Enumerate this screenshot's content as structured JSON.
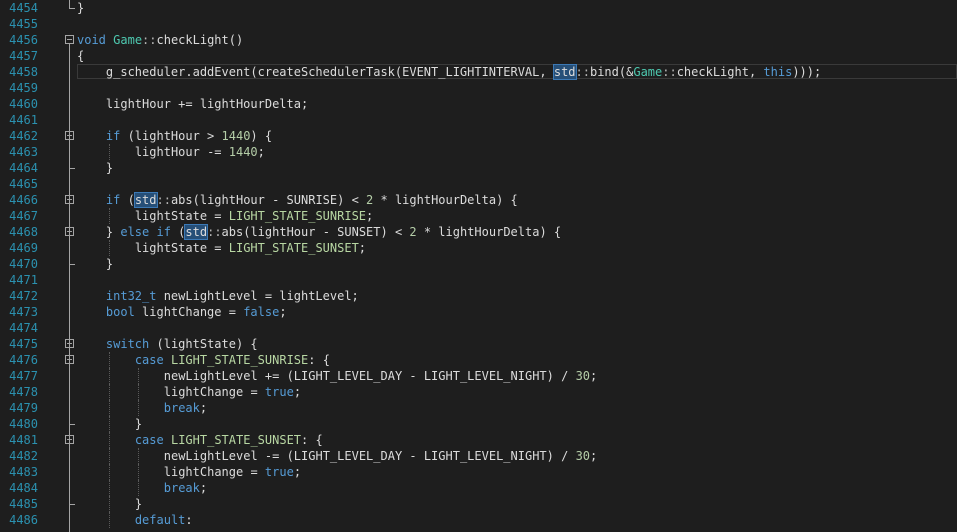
{
  "editor": {
    "lines": [
      {
        "n": "4454",
        "fold": "end",
        "ind": 0,
        "t": [
          [
            "p",
            "}"
          ]
        ]
      },
      {
        "n": "4455",
        "ind": 0,
        "t": []
      },
      {
        "n": "4456",
        "fold": "open",
        "ind": 0,
        "t": [
          [
            "kw",
            "void"
          ],
          [
            "p",
            " "
          ],
          [
            "ty",
            "Game"
          ],
          [
            "op",
            "::"
          ],
          [
            "p",
            "checkLight()"
          ]
        ]
      },
      {
        "n": "4457",
        "ind": 0,
        "t": [
          [
            "p",
            "{"
          ]
        ]
      },
      {
        "n": "4458",
        "ind": 1,
        "current": true,
        "t": [
          [
            "p",
            "g_scheduler.addEvent(createSchedulerTask(EVENT_LIGHTINTERVAL, "
          ],
          [
            "hl",
            "std"
          ],
          [
            "op",
            "::"
          ],
          [
            "p",
            "bind(&"
          ],
          [
            "ty",
            "Game"
          ],
          [
            "op",
            "::"
          ],
          [
            "p",
            "checkLight, "
          ],
          [
            "kw",
            "this"
          ],
          [
            "p",
            ")));"
          ]
        ]
      },
      {
        "n": "4459",
        "ind": 1,
        "t": []
      },
      {
        "n": "4460",
        "ind": 1,
        "t": [
          [
            "p",
            "lightHour += lightHourDelta;"
          ]
        ]
      },
      {
        "n": "4461",
        "ind": 1,
        "t": []
      },
      {
        "n": "4462",
        "fold": "open",
        "ind": 1,
        "t": [
          [
            "kw",
            "if"
          ],
          [
            "p",
            " (lightHour > "
          ],
          [
            "num",
            "1440"
          ],
          [
            "p",
            ") {"
          ]
        ]
      },
      {
        "n": "4463",
        "ind": 2,
        "t": [
          [
            "p",
            "lightHour -= "
          ],
          [
            "num",
            "1440"
          ],
          [
            "p",
            ";"
          ]
        ]
      },
      {
        "n": "4464",
        "fold": "end",
        "ind": 1,
        "t": [
          [
            "p",
            "}"
          ]
        ]
      },
      {
        "n": "4465",
        "ind": 1,
        "t": []
      },
      {
        "n": "4466",
        "fold": "open",
        "ind": 1,
        "t": [
          [
            "kw",
            "if"
          ],
          [
            "p",
            " ("
          ],
          [
            "hl",
            "std"
          ],
          [
            "op",
            "::"
          ],
          [
            "p",
            "abs(lightHour - SUNRISE) < "
          ],
          [
            "num",
            "2"
          ],
          [
            "p",
            " * lightHourDelta) {"
          ]
        ]
      },
      {
        "n": "4467",
        "ind": 2,
        "t": [
          [
            "p",
            "lightState = "
          ],
          [
            "en",
            "LIGHT_STATE_SUNRISE"
          ],
          [
            "p",
            ";"
          ]
        ]
      },
      {
        "n": "4468",
        "fold": "open",
        "ind": 1,
        "t": [
          [
            "p",
            "} "
          ],
          [
            "kw",
            "else"
          ],
          [
            "p",
            " "
          ],
          [
            "kw",
            "if"
          ],
          [
            "p",
            " ("
          ],
          [
            "hl",
            "std"
          ],
          [
            "op",
            "::"
          ],
          [
            "p",
            "abs(lightHour - SUNSET) < "
          ],
          [
            "num",
            "2"
          ],
          [
            "p",
            " * lightHourDelta) {"
          ]
        ]
      },
      {
        "n": "4469",
        "ind": 2,
        "t": [
          [
            "p",
            "lightState = "
          ],
          [
            "en",
            "LIGHT_STATE_SUNSET"
          ],
          [
            "p",
            ";"
          ]
        ]
      },
      {
        "n": "4470",
        "fold": "end",
        "ind": 1,
        "t": [
          [
            "p",
            "}"
          ]
        ]
      },
      {
        "n": "4471",
        "ind": 1,
        "t": []
      },
      {
        "n": "4472",
        "ind": 1,
        "t": [
          [
            "kw",
            "int32_t"
          ],
          [
            "p",
            " newLightLevel = lightLevel;"
          ]
        ]
      },
      {
        "n": "4473",
        "ind": 1,
        "t": [
          [
            "kw",
            "bool"
          ],
          [
            "p",
            " lightChange = "
          ],
          [
            "kw",
            "false"
          ],
          [
            "p",
            ";"
          ]
        ]
      },
      {
        "n": "4474",
        "ind": 1,
        "t": []
      },
      {
        "n": "4475",
        "fold": "open",
        "ind": 1,
        "t": [
          [
            "kw",
            "switch"
          ],
          [
            "p",
            " (lightState) {"
          ]
        ]
      },
      {
        "n": "4476",
        "fold": "open",
        "ind": 2,
        "t": [
          [
            "kw",
            "case"
          ],
          [
            "p",
            " "
          ],
          [
            "en",
            "LIGHT_STATE_SUNRISE"
          ],
          [
            "p",
            ": {"
          ]
        ]
      },
      {
        "n": "4477",
        "ind": 3,
        "t": [
          [
            "p",
            "newLightLevel += (LIGHT_LEVEL_DAY - LIGHT_LEVEL_NIGHT) / "
          ],
          [
            "num",
            "30"
          ],
          [
            "p",
            ";"
          ]
        ]
      },
      {
        "n": "4478",
        "ind": 3,
        "t": [
          [
            "p",
            "lightChange = "
          ],
          [
            "kw",
            "true"
          ],
          [
            "p",
            ";"
          ]
        ]
      },
      {
        "n": "4479",
        "ind": 3,
        "t": [
          [
            "kw",
            "break"
          ],
          [
            "p",
            ";"
          ]
        ]
      },
      {
        "n": "4480",
        "fold": "end",
        "ind": 2,
        "t": [
          [
            "p",
            "}"
          ]
        ]
      },
      {
        "n": "4481",
        "fold": "open",
        "ind": 2,
        "t": [
          [
            "kw",
            "case"
          ],
          [
            "p",
            " "
          ],
          [
            "en",
            "LIGHT_STATE_SUNSET"
          ],
          [
            "p",
            ": {"
          ]
        ]
      },
      {
        "n": "4482",
        "ind": 3,
        "t": [
          [
            "p",
            "newLightLevel -= (LIGHT_LEVEL_DAY - LIGHT_LEVEL_NIGHT) / "
          ],
          [
            "num",
            "30"
          ],
          [
            "p",
            ";"
          ]
        ]
      },
      {
        "n": "4483",
        "ind": 3,
        "t": [
          [
            "p",
            "lightChange = "
          ],
          [
            "kw",
            "true"
          ],
          [
            "p",
            ";"
          ]
        ]
      },
      {
        "n": "4484",
        "ind": 3,
        "t": [
          [
            "kw",
            "break"
          ],
          [
            "p",
            ";"
          ]
        ]
      },
      {
        "n": "4485",
        "fold": "end",
        "ind": 2,
        "t": [
          [
            "p",
            "}"
          ]
        ]
      },
      {
        "n": "4486",
        "ind": 2,
        "t": [
          [
            "kw",
            "default"
          ],
          [
            "p",
            ":"
          ]
        ]
      }
    ]
  },
  "colors": {
    "background": "#1e1e1e",
    "line_number": "#2b91af",
    "keyword": "#569cd6",
    "type": "#4ec9b0",
    "number": "#b5cea8",
    "enum": "#b8d7a3",
    "text": "#dcdcdc",
    "highlight": "#264f78"
  }
}
